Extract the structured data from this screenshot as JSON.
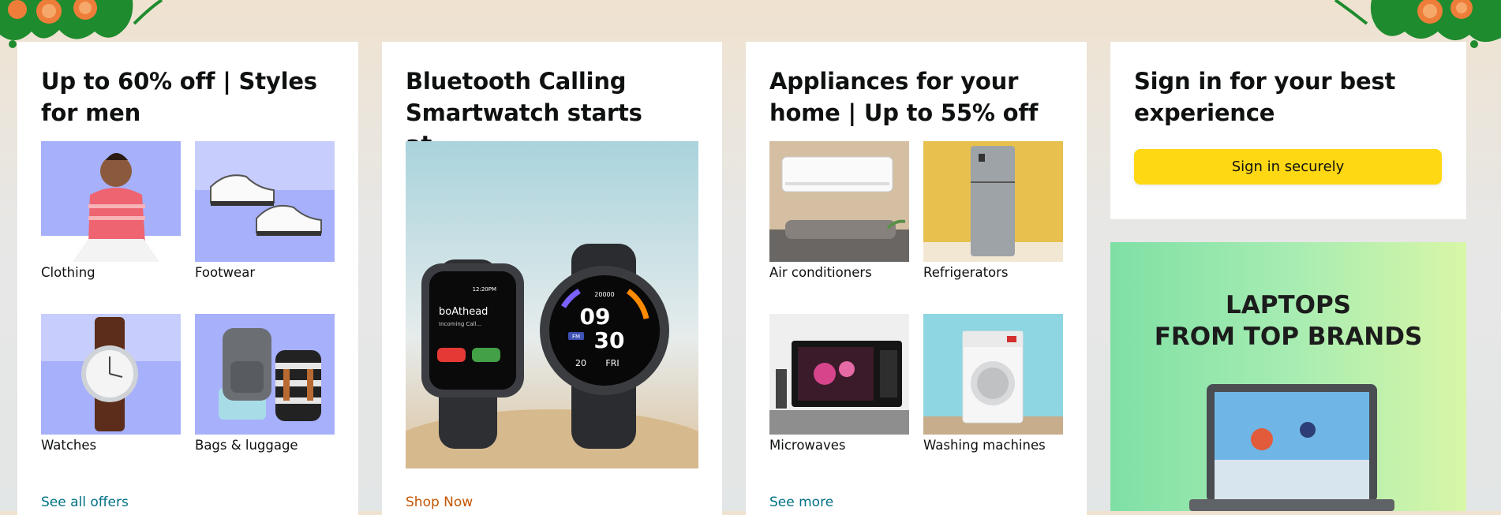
{
  "cards": [
    {
      "title": "Up to 60% off | Styles for men",
      "tiles": [
        {
          "label": "Clothing"
        },
        {
          "label": "Footwear"
        },
        {
          "label": "Watches"
        },
        {
          "label": "Bags & luggage"
        }
      ],
      "link": "See all offers"
    },
    {
      "title": "Bluetooth Calling Smartwatch starts at...",
      "link": "Shop Now",
      "watch_screen": {
        "brand": "boAthead",
        "call_text": "Incoming Call...",
        "time_top": "12:20PM",
        "hour": "09",
        "minute": "30",
        "date": "20",
        "day": "FRI",
        "steps": "20000",
        "badge": "FM"
      }
    },
    {
      "title": "Appliances for your home | Up to 55% off",
      "tiles": [
        {
          "label": "Air conditioners"
        },
        {
          "label": "Refrigerators"
        },
        {
          "label": "Microwaves"
        },
        {
          "label": "Washing machines"
        }
      ],
      "link": "See more"
    },
    {
      "title": "Sign in for your best experience",
      "button": "Sign in securely"
    }
  ],
  "ad": {
    "headline": "LAPTOPS\nFROM TOP BRANDS"
  },
  "colors": {
    "link": "#007185",
    "shop_link": "#c45500",
    "signin_button": "#ffd814",
    "tile_blue": "#a6b0fb"
  }
}
